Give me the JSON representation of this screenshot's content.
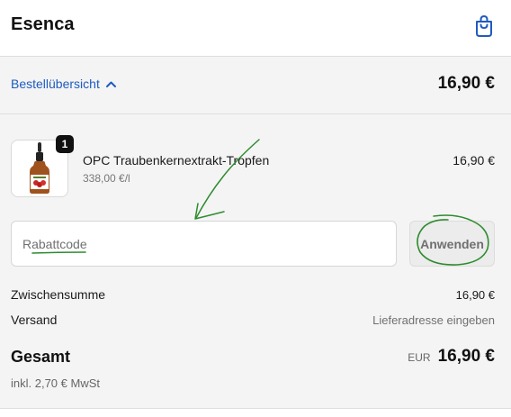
{
  "header": {
    "brand": "Esenca",
    "cart_icon": "shopping-bag-icon"
  },
  "summary_bar": {
    "toggle_label": "Bestellübersicht",
    "toggle_icon": "chevron-up-icon",
    "total": "16,90 €"
  },
  "cart": {
    "items": [
      {
        "quantity": "1",
        "name": "OPC Traubenkernextrakt-Tropfen",
        "unit_price": "338,00 €/l",
        "price": "16,90 €",
        "image_icon": "dropper-bottle-icon"
      }
    ]
  },
  "discount": {
    "placeholder": "Rabattcode",
    "value": "",
    "apply_label": "Anwenden"
  },
  "totals": {
    "subtotal_label": "Zwischensumme",
    "subtotal_value": "16,90 €",
    "shipping_label": "Versand",
    "shipping_value": "Lieferadresse eingeben",
    "total_label": "Gesamt",
    "total_currency": "EUR",
    "total_value": "16,90 €",
    "tax_note": "inkl. 2,70 € MwSt"
  },
  "colors": {
    "accent_link": "#1f5bbf",
    "annotation_ink": "#2e8b2e",
    "panel_bg": "#f4f4f4"
  }
}
